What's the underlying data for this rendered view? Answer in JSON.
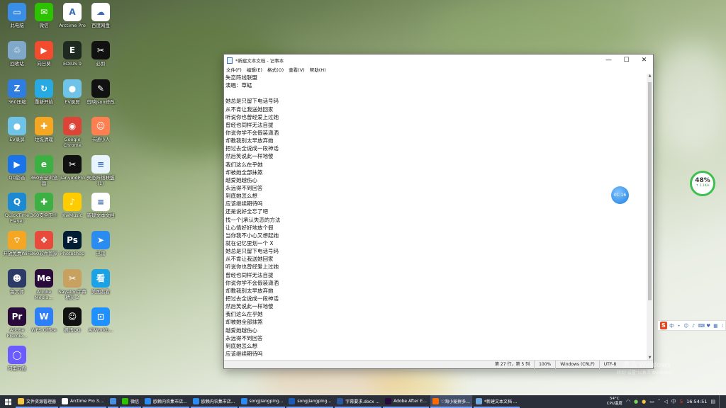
{
  "desktop_icons": [
    {
      "label": "此电脑",
      "icon": "computer-icon",
      "color": "#3a8ee6",
      "glyph": "▭"
    },
    {
      "label": "微信",
      "icon": "wechat-icon",
      "color": "#2dc100",
      "glyph": "✉"
    },
    {
      "label": "Arctime Pro",
      "icon": "arctime-icon",
      "color": "#ffffff",
      "glyph": "A"
    },
    {
      "label": "百度网盘",
      "icon": "baidu-netdisk-icon",
      "color": "#ffffff",
      "glyph": "☁"
    },
    {
      "label": "回收站",
      "icon": "recycle-bin-icon",
      "color": "#7fa8c9",
      "glyph": "♲"
    },
    {
      "label": "向日葵",
      "icon": "sunflower-icon",
      "color": "#f24b2d",
      "glyph": "▶"
    },
    {
      "label": "EDIUS 9",
      "icon": "edius-icon",
      "color": "#1e2a20",
      "glyph": "E"
    },
    {
      "label": "必剪",
      "icon": "bijian-icon",
      "color": "#111111",
      "glyph": "✂"
    },
    {
      "label": "360压缩",
      "icon": "compress-360-icon",
      "color": "#2f7de1",
      "glyph": "Z"
    },
    {
      "label": "重新开始",
      "icon": "restart-icon",
      "color": "#27a9e1",
      "glyph": "↻"
    },
    {
      "label": "EV录屏",
      "icon": "ev-record-icon",
      "color": "#6fc3e9",
      "glyph": "●"
    },
    {
      "label": "剪映json修改",
      "icon": "capcut-json-icon",
      "color": "#111111",
      "glyph": "✎"
    },
    {
      "label": "EV录屏",
      "icon": "ev-record-icon-2",
      "color": "#6fc3e9",
      "glyph": "●"
    },
    {
      "label": "垃圾清理",
      "icon": "cleaner-icon",
      "color": "#f5a623",
      "glyph": "✚"
    },
    {
      "label": "Google Chrome",
      "icon": "chrome-icon",
      "color": "#db4437",
      "glyph": "◉"
    },
    {
      "label": "卡通小人",
      "icon": "cartoon-icon",
      "color": "#ff7f50",
      "glyph": "☺"
    },
    {
      "label": "QQ影音",
      "icon": "qq-player-icon",
      "color": "#1a73e8",
      "glyph": "▶"
    },
    {
      "label": "360安全浏览器",
      "icon": "browser-360-icon",
      "color": "#3cb043",
      "glyph": "e"
    },
    {
      "label": "JianyingPro",
      "icon": "jianying-icon",
      "color": "#111111",
      "glyph": "✂"
    },
    {
      "label": "失恋阵线联盟 (1)",
      "icon": "document-icon",
      "color": "#e8f4ff",
      "glyph": "≡"
    },
    {
      "label": "QuickTime Player",
      "icon": "quicktime-icon",
      "color": "#1b8ad3",
      "glyph": "Q"
    },
    {
      "label": "360安全卫士",
      "icon": "security-360-icon",
      "color": "#3cb043",
      "glyph": "✚"
    },
    {
      "label": "KwMusic",
      "icon": "kwmusic-icon",
      "color": "#ffcc00",
      "glyph": "♪"
    },
    {
      "label": "新建文本文档",
      "icon": "text-file-icon",
      "color": "#ffffff",
      "glyph": "≡"
    },
    {
      "label": "开放免费WiFi",
      "icon": "wifi-icon",
      "color": "#f5a623",
      "glyph": "⌔"
    },
    {
      "label": "360软件管家",
      "icon": "software-360-icon",
      "color": "#e84b3c",
      "glyph": "❖"
    },
    {
      "label": "Photoshop",
      "icon": "photoshop-icon",
      "color": "#001d34",
      "glyph": "Ps"
    },
    {
      "label": "迅雷",
      "icon": "thunder-icon",
      "color": "#2a8cf0",
      "glyph": "➤"
    },
    {
      "label": "鲁大师",
      "icon": "ludashi-icon",
      "color": "#2b3a67",
      "glyph": "☻"
    },
    {
      "label": "Adobe Media...",
      "icon": "adobe-media-icon",
      "color": "#2a0a3a",
      "glyph": "Me"
    },
    {
      "label": "Sayatoo字幕精灵 2",
      "icon": "sayatoo-icon",
      "color": "#c8a060",
      "glyph": "✂"
    },
    {
      "label": "美图看看",
      "icon": "meitu-icon",
      "color": "#1aa1e6",
      "glyph": "看"
    },
    {
      "label": "Adobe Premie...",
      "icon": "premiere-icon",
      "color": "#2a0a3a",
      "glyph": "Pr"
    },
    {
      "label": "WPS Office",
      "icon": "wps-icon",
      "color": "#2d7ff9",
      "glyph": "W"
    },
    {
      "label": "腾讯QQ",
      "icon": "qq-icon",
      "color": "#111111",
      "glyph": "☺"
    },
    {
      "label": "AliWorkb...",
      "icon": "aliworkbench-icon",
      "color": "#1e90ff",
      "glyph": "⊡"
    },
    {
      "label": "阿里云盘",
      "icon": "aliyun-drive-icon",
      "color": "#6a5cff",
      "glyph": "◯"
    }
  ],
  "notepad": {
    "title": "*新建文本文档 - 记事本",
    "menu": [
      "文件(F)",
      "编辑(E)",
      "格式(O)",
      "查看(V)",
      "帮助(H)"
    ],
    "lines": [
      "失恋阵线联盟",
      "演唱：草蜢",
      "",
      "她总是只留下电话号码",
      "从不肯让我送她回家",
      "听说你也曾经爱上过她",
      "曾经也同样无法自拔",
      "你说你学不会假装潇洒",
      "却教我别太早放弃她",
      "把过去全说成一段神话",
      "然后笑说此一样地傻",
      "我们这么在乎她",
      "却被她全部抹煞",
      "越爱她越伤心",
      "永远得不到回答",
      "到底她怎么想",
      "应该继续期待吗",
      "还是说好全忘了吧",
      "找一个|承认失恋的方法",
      "让心情好好地放个假",
      "当你我不小心又想起她",
      "就在记忆里划一个 X",
      "她总是只留下电话号码",
      "从不肯让我送她回家",
      "听说你也曾经爱上过她",
      "曾经也同样无法自拔",
      "你说你学不会假装潇洒",
      "却教我别太早放弃她",
      "把过去全说成一段神话",
      "然后笑说此一样地傻",
      "我们这么在乎她",
      "却被她全部抹煞",
      "越爱她越伤心",
      "永远得不到回答",
      "到底她怎么想",
      "应该继续期待吗"
    ],
    "status": {
      "position": "第 27 行，第 5 列",
      "zoom": "100%",
      "line_ending": "Windows (CRLF)",
      "encoding": "UTF-8"
    }
  },
  "widgets": {
    "cpu_percent": "48%",
    "net_speed": "↑ 1.1K/s",
    "timer": "01:16"
  },
  "watermark": {
    "line1": "激活 Windows",
    "line2": "转到\"设置\"以激活 Windows。"
  },
  "taskbar": {
    "items": [
      {
        "label": "文件资源管理器",
        "color": "#f5c542",
        "active": false
      },
      {
        "label": "Arctime Pro 3....",
        "color": "#ffffff",
        "active": false
      },
      {
        "label": "",
        "color": "#4a90e2",
        "active": false
      },
      {
        "label": "微信",
        "color": "#2dc100",
        "active": false
      },
      {
        "label": "欧赖内农集市店...",
        "color": "#2a8cf0",
        "active": false
      },
      {
        "label": "欧赖内农集市店...",
        "color": "#2a8cf0",
        "active": false
      },
      {
        "label": "songjiangping...",
        "color": "#2a8cf0",
        "active": false
      },
      {
        "label": "songjiangping...",
        "color": "#1e5bb8",
        "active": false
      },
      {
        "label": "字幕要求.docx ...",
        "color": "#2b579a",
        "active": false
      },
      {
        "label": "Adobe After E...",
        "color": "#2a0a3a",
        "active": false
      },
      {
        "label": "♡淘小秘拼多...",
        "color": "#ff6a00",
        "active": true
      },
      {
        "label": "*新建文本文档 ...",
        "color": "#6fa8dc",
        "active": false
      }
    ],
    "temp": "54°C",
    "temp_label": "CPU温度",
    "clock": "16:54:51"
  }
}
